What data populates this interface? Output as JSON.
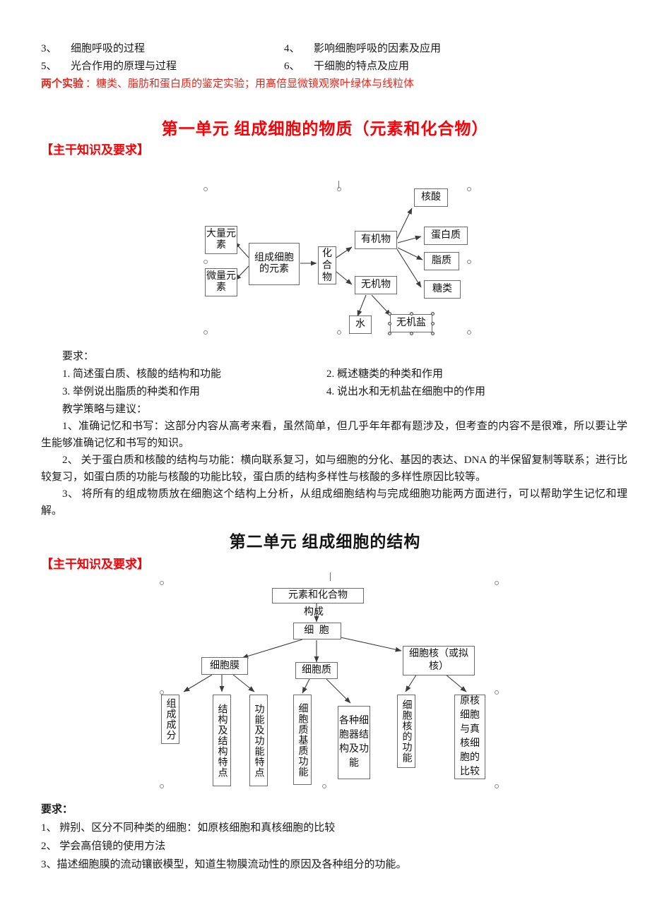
{
  "header_list": {
    "items": [
      {
        "num": "3、",
        "text": "细胞呼吸的过程"
      },
      {
        "num": "4、",
        "text": "影响细胞呼吸的因素及应用"
      },
      {
        "num": "5、",
        "text": "光合作用的原理与过程"
      },
      {
        "num": "6、",
        "text": "干细胞的特点及应用"
      }
    ],
    "experiments_label": "两个实验",
    "experiments_text": "：糖类、脂肪和蛋白质的鉴定实验；用高倍显微镜观察叶绿体与线粒体"
  },
  "unit1": {
    "title": "第一单元   组成细胞的物质（元素和化合物）",
    "section_head": "【主干知识及要求】",
    "diagram": {
      "nodes": {
        "macro": "大量元素",
        "micro": "微量元素",
        "elements": "组成细胞的元素",
        "compound": "化合物",
        "organic": "有机物",
        "inorganic": "无机物",
        "nucleic": "核酸",
        "protein": "蛋白质",
        "lipid": "脂质",
        "sugar": "糖类",
        "water": "水",
        "salt": "无机盐"
      }
    },
    "requirements_label": "要求：",
    "requirements": [
      "1. 简述蛋白质、核酸的结构和功能",
      "2. 概述糖类的种类和作用",
      "3. 举例说出脂质的种类和作用",
      "4. 说出水和无机盐在细胞中的作用"
    ],
    "strategy_label": "教学策略与建议：",
    "strategy": [
      "1、准确记忆和书写：这部分内容从高考来看，虽然简单，但几乎年年都有题涉及，但考查的内容不是很难，所以要让学生能够准确记忆和书写的知识。",
      "2、 关于蛋白质和核酸的结构与功能：横向联系复习，如与细胞的分化、基因的表达、DNA 的半保留复制等联系；进行比较复习，如蛋白质的功能与核酸的功能比较，蛋白质的结构多样性与核酸的多样性原因比较等。",
      "3、 将所有的组成物质放在细胞这个结构上分析，从组成细胞结构与完成细胞功能两方面进行，可以帮助学生记忆和理解。"
    ]
  },
  "unit2": {
    "title": "第二单元    组成细胞的结构",
    "section_head": "【主干知识及要求】",
    "diagram": {
      "nodes": {
        "source": "元素和化合物",
        "edge_label": "构成",
        "cell": "细  胞",
        "membrane": "细胞膜",
        "cytoplasm": "细胞质",
        "nucleus": "细胞核（或拟核）",
        "leaf_composition": "组成成分",
        "leaf_structure": "结构及结构特点",
        "leaf_function": "功能及功能特点",
        "leaf_matrix": "细胞质基质功能",
        "leaf_organelle": "各种细胞器结构及功能",
        "leaf_nucleus_func": "细胞核的功能",
        "leaf_compare": "原核细胞与真核细胞的比较"
      }
    },
    "requirements_label": "要求：",
    "requirements": [
      "1、  辨别、区分不同种类的细胞：如原核细胞和真核细胞的比较",
      "2、  学会高倍镜的使用方法",
      "3、描述细胞膜的流动镶嵌模型，知道生物膜流动性的原因及各种组分的功能。"
    ]
  },
  "colors": {
    "red": "#e8251b",
    "title_red": "#fb0007",
    "text": "#1a1a1a",
    "box_border": "#6b6b6b"
  }
}
